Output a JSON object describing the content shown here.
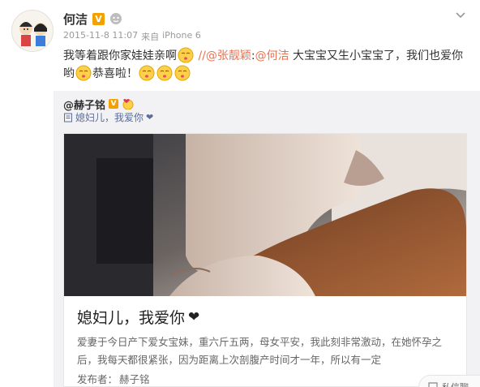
{
  "post": {
    "author": "何洁",
    "verified_mark": "V",
    "timestamp": "2015-11-8 11:07",
    "source_label": "来自",
    "device": "iPhone 6",
    "text_part1": "我等着跟你家娃娃亲啊",
    "slashes": " //",
    "mention1": "@张靓颖",
    "colon": ":",
    "mention2": "@何洁",
    "text_part2": " 大宝宝又生小宝宝了，我们也爱你哟",
    "text_part3": "恭喜啦！"
  },
  "repost": {
    "author": "@赫子铭",
    "verified_mark": "V",
    "body": "媳妇儿，我爱你",
    "card": {
      "title": "媳妇儿，我爱你",
      "description": "爱妻于今日产下爱女宝妹，重六斤五两，母女平安，我此刻非常激动，在她怀孕之后，我每天都很紧张，因为距离上次剖腹产时间才一年，所以有一定",
      "author_label": "发布者：",
      "author_name": "赫子铭"
    }
  },
  "chat": {
    "label": "私信聊"
  },
  "colors": {
    "accent": "#eb7350",
    "link": "#5a6e9c",
    "verified": "#f2a100"
  },
  "icons": [
    "avatar",
    "verified-icon",
    "vip-face-icon",
    "chevron-down-icon",
    "kiss-emoji-icon",
    "heart-icon",
    "doc-icon",
    "chat-icon"
  ]
}
